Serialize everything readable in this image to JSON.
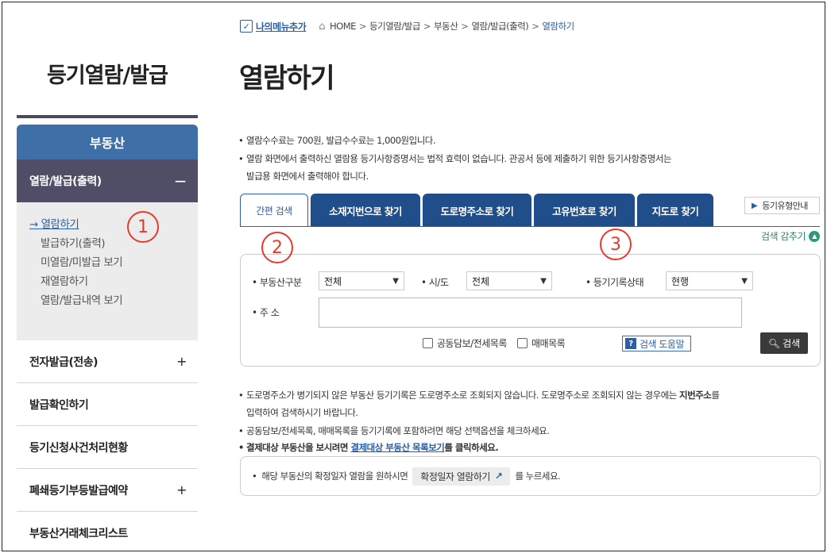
{
  "sidebar": {
    "title": "등기열람/발급",
    "category": "부동산",
    "sub_head": "열람/발급(출력)",
    "sub_head_toggle": "−",
    "sub_items": [
      "→ 열람하기",
      "발급하기(출력)",
      "미열람/미발급 보기",
      "재열람하기",
      "열람/발급내역 보기"
    ],
    "nav_items": [
      {
        "label": "전자발급(전송)",
        "toggle": "+"
      },
      {
        "label": "발급확인하기",
        "toggle": ""
      },
      {
        "label": "등기신청사건처리현황",
        "toggle": ""
      },
      {
        "label": "폐쇄등기부등발급예약",
        "toggle": "+"
      },
      {
        "label": "부동산거래체크리스트",
        "toggle": ""
      }
    ]
  },
  "breadcrumb": {
    "my_menu": "나의메뉴추가",
    "items": [
      "HOME",
      "등기열람/발급",
      "부동산",
      "열람/발급(출력)"
    ],
    "separator": ">",
    "current": "열람하기"
  },
  "page_title": "열람하기",
  "notices_top": [
    "열람수수료는 700원, 발급수수료는 1,000원입니다.",
    "열람 화면에서 출력하신 열람용 등기사항증명서는 법적 효력이 없습니다. 관공서 등에 제출하기 위한 등기사항증명서는",
    "발급용 화면에서 출력해야 합니다."
  ],
  "tabs": [
    "간편 검색",
    "소재지번으로 찾기",
    "도로명주소로 찾기",
    "고유번호로 찾기",
    "지도로 찾기"
  ],
  "guide_button": "등기유형안내",
  "fold_label": "검색 감추기",
  "search": {
    "type_label": "• 부동산구분",
    "type_value": "전체",
    "sido_label": "• 시/도",
    "sido_value": "전체",
    "status_label": "• 등기기록상태",
    "status_value": "현행",
    "address_label": "• 주 소",
    "address_value": "",
    "check_joint": "공동담보/전세목록",
    "check_sale": "매매목록",
    "help_button": "검색 도움말",
    "search_button": "검색"
  },
  "notices_bottom": {
    "line1_a": "도로명주소가 병기되지 않은 부동산 등기기록은 도로명주소로 조회되지 않습니다. 도로명주소로 조회되지 않는 경우에는 ",
    "line1_bold": "지번주소",
    "line1_b": "를",
    "line2": "입력하여 검색하시기 바랍니다.",
    "line3": "공동담보/전세목록, 매매목록을 등기기록에 포함하려면 해당 선택옵션을 체크하세요.",
    "line4_a": "결제대상 부동산을 보시려면 ",
    "line4_link": "결제대상 부동산 목록보기",
    "line4_b": "를 클릭하세요."
  },
  "note_box": {
    "text_a": "해당 부동산의 확정일자 열람을 원하시면",
    "button": "확정일자 열람하기",
    "text_b": "를 누르세요."
  },
  "annotations": [
    "1",
    "2",
    "3"
  ],
  "colors": {
    "primary": "#3e6fa7",
    "tab": "#1f4e8a",
    "sub_head": "#4f4e66",
    "annotation": "#e83a2a"
  }
}
